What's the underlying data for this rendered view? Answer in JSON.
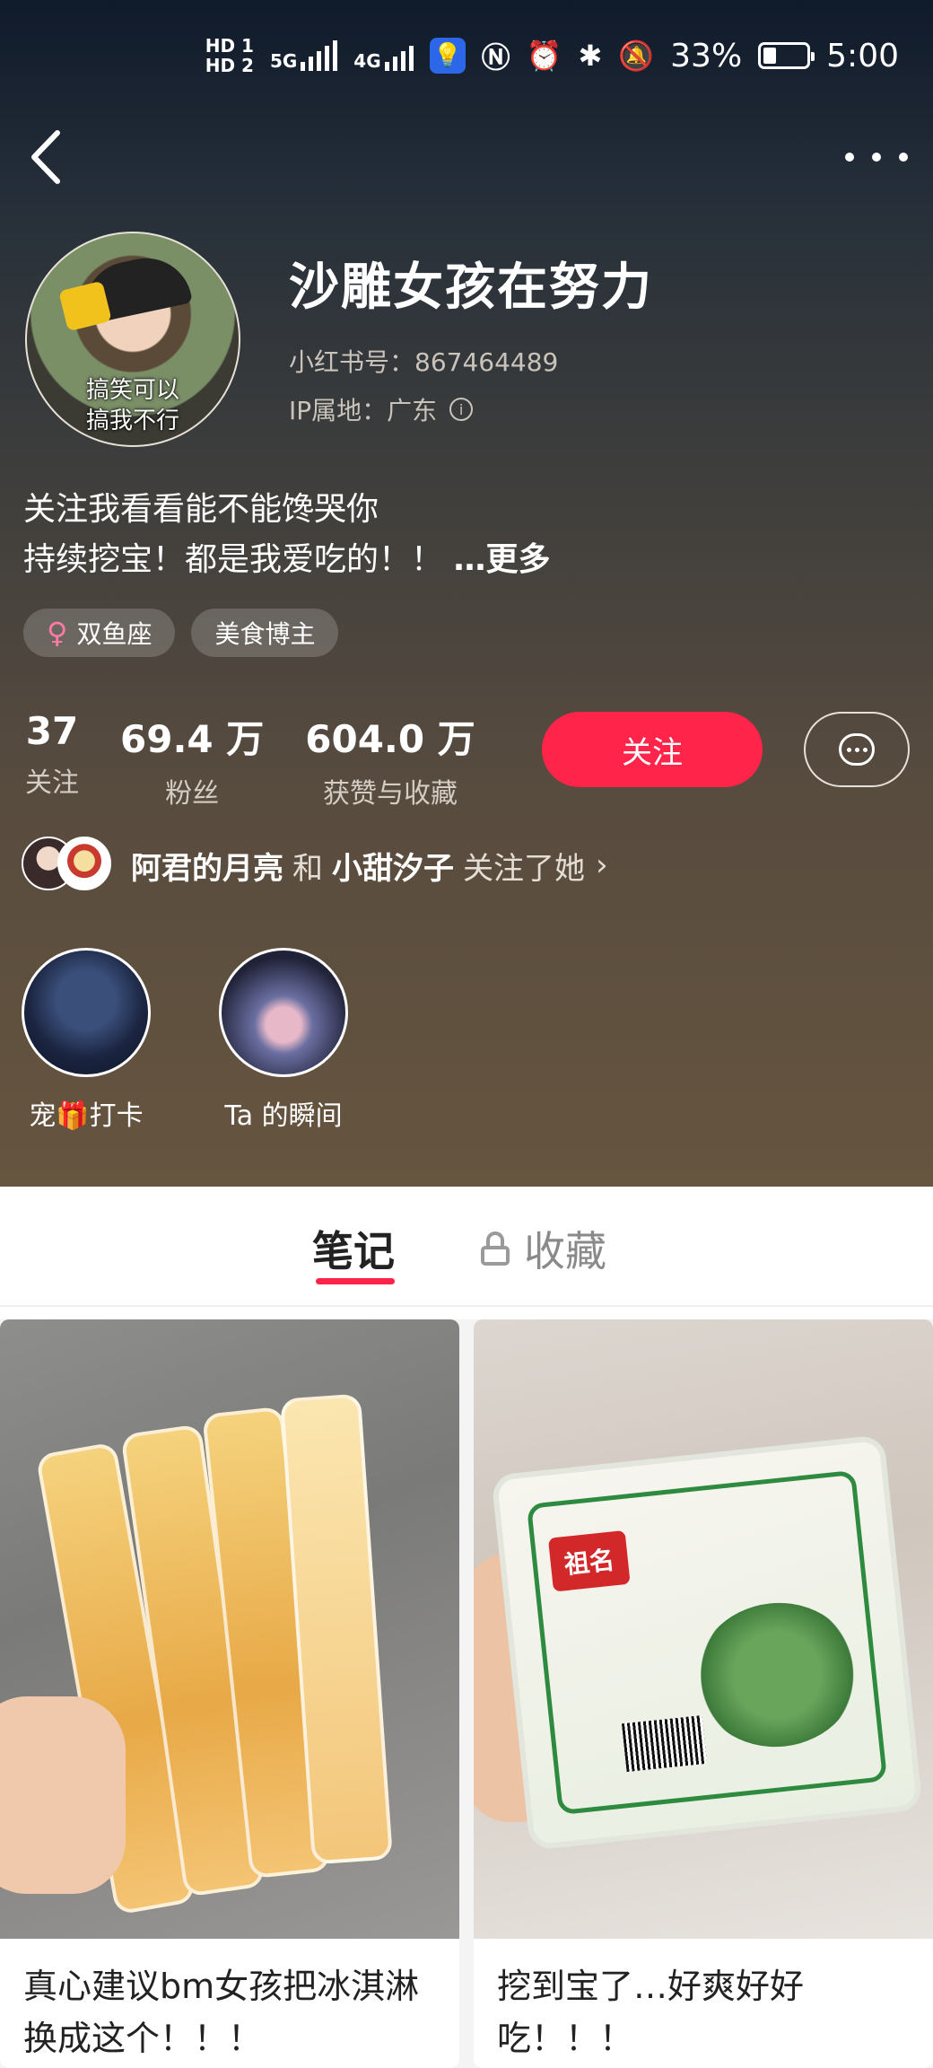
{
  "status_bar": {
    "hd1": "HD 1",
    "hd2": "HD 2",
    "net1": "5G",
    "net2": "4G",
    "battery": "33%",
    "time": "5:00"
  },
  "profile": {
    "nickname": "沙雕女孩在努力",
    "redbook_id": "小红书号：867464489",
    "ip_location": "IP属地：广东",
    "avatar_caption_line1": "搞笑可以",
    "avatar_caption_line2": "搞我不行",
    "bio_line1": "关注我看看能不能馋哭你",
    "bio_line2": "持续挖宝！都是我爱吃的！！",
    "bio_more": "…更多"
  },
  "tags": [
    {
      "icon": "female-icon",
      "symbol": "♀",
      "label": "双鱼座"
    },
    {
      "label": "美食博主"
    }
  ],
  "stats": [
    {
      "num": "37",
      "label": "关注"
    },
    {
      "num": "69.4 万",
      "label": "粉丝"
    },
    {
      "num": "604.0 万",
      "label": "获赞与收藏"
    }
  ],
  "actions": {
    "follow_label": "关注"
  },
  "mutual": {
    "user1": "阿君的月亮",
    "and": "和",
    "user2": "小甜汐子",
    "suffix": "关注了她",
    "chevron": "›"
  },
  "highlights": [
    {
      "label": "宠🎁打卡"
    },
    {
      "label": "Ta 的瞬间"
    }
  ],
  "tabs": {
    "notes": "笔记",
    "collections": "收藏"
  },
  "feed": [
    {
      "title": "真心建议bm女孩把冰淇淋换成这个！！！"
    },
    {
      "title": "挖到宝了…好爽好好吃！！！",
      "brand": "祖名"
    }
  ],
  "colors": {
    "accent": "#ff2449",
    "header_top": "#0f1a2b",
    "header_bottom": "#66553f"
  }
}
